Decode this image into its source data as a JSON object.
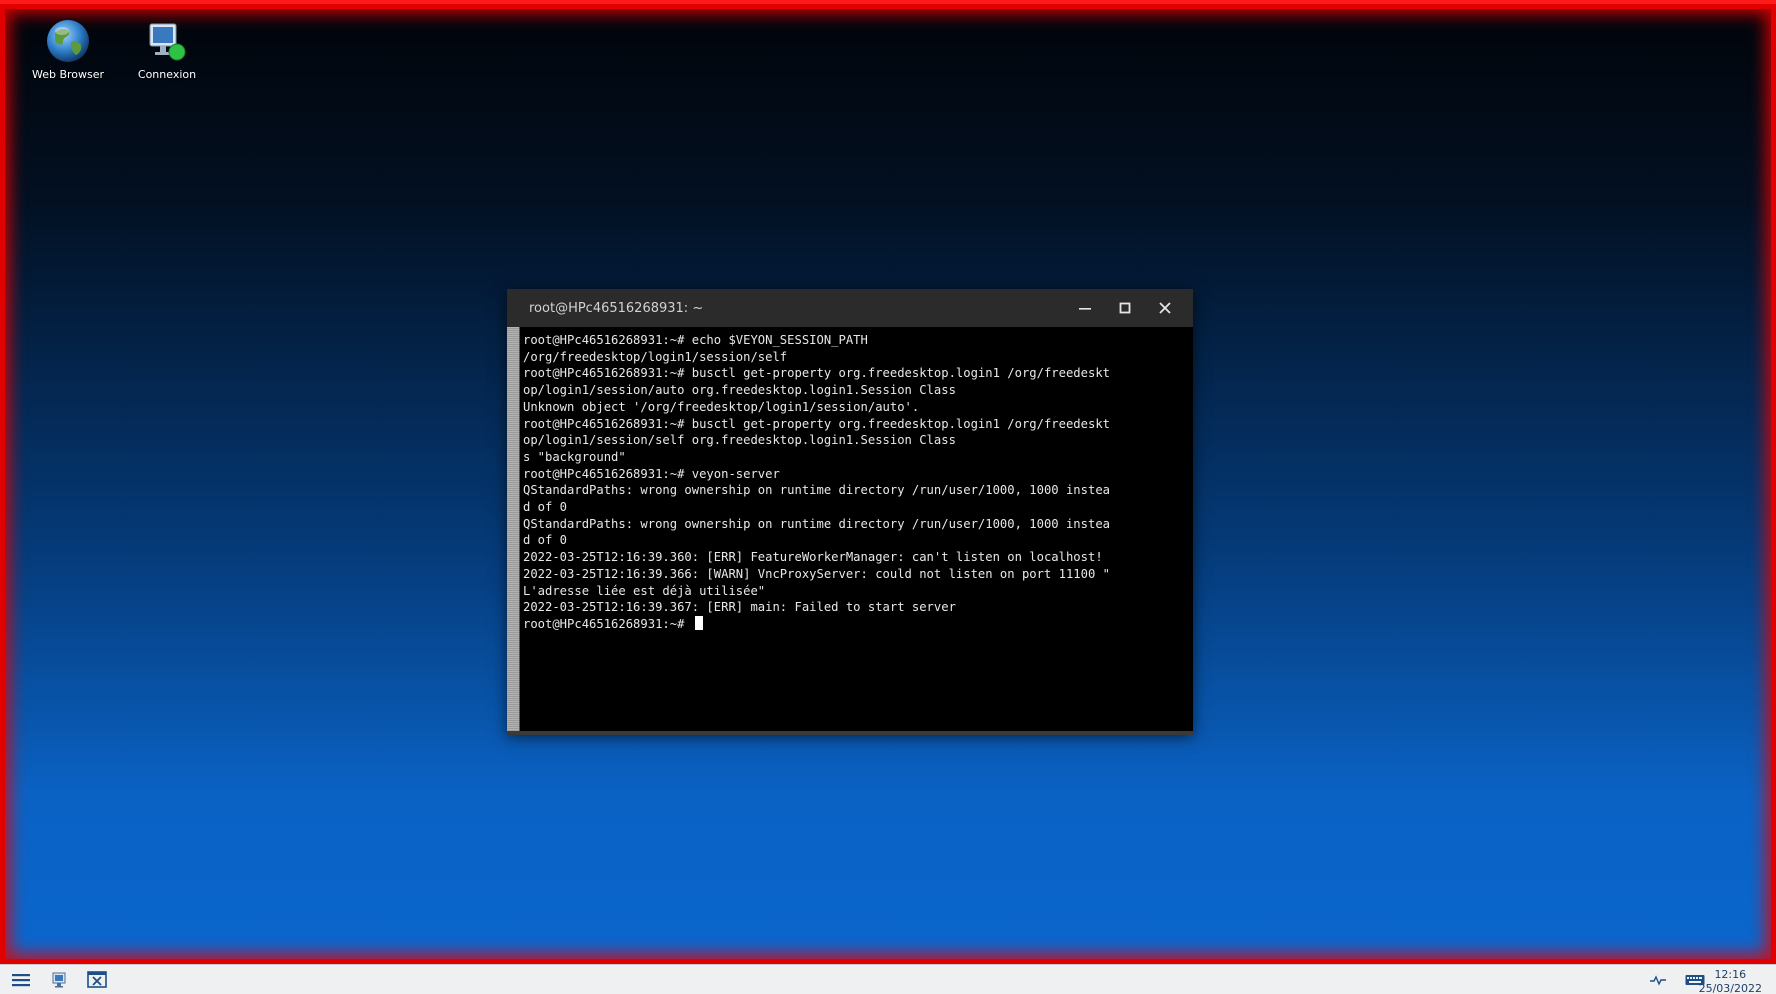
{
  "desktop": {
    "icons": [
      {
        "label": "Web Browser",
        "icon": "globe-icon"
      },
      {
        "label": "Connexion",
        "icon": "monitor-connect-icon"
      }
    ]
  },
  "terminal": {
    "title": "root@HPc46516268931: ~",
    "lines": [
      "root@HPc46516268931:~# echo $VEYON_SESSION_PATH",
      "/org/freedesktop/login1/session/self",
      "root@HPc46516268931:~# busctl get-property org.freedesktop.login1 /org/freedeskt",
      "op/login1/session/auto org.freedesktop.login1.Session Class",
      "Unknown object '/org/freedesktop/login1/session/auto'.",
      "root@HPc46516268931:~# busctl get-property org.freedesktop.login1 /org/freedeskt",
      "op/login1/session/self org.freedesktop.login1.Session Class",
      "s \"background\"",
      "root@HPc46516268931:~# veyon-server",
      "QStandardPaths: wrong ownership on runtime directory /run/user/1000, 1000 instea",
      "d of 0",
      "QStandardPaths: wrong ownership on runtime directory /run/user/1000, 1000 instea",
      "d of 0",
      "2022-03-25T12:16:39.360: [ERR] FeatureWorkerManager: can't listen on localhost!",
      "2022-03-25T12:16:39.366: [WARN] VncProxyServer: could not listen on port 11100 \"",
      "L'adresse liée est déjà utilisée\"",
      "2022-03-25T12:16:39.367: [ERR] main: Failed to start server"
    ],
    "prompt": "root@HPc46516268931:~# "
  },
  "taskbar": {
    "clock_time": "12:16",
    "clock_date": "25/03/2022"
  },
  "colors": {
    "frame_accent": "#e00000",
    "taskbar_bg": "#eef0f2",
    "titlebar_bg": "#2b2b2b"
  }
}
